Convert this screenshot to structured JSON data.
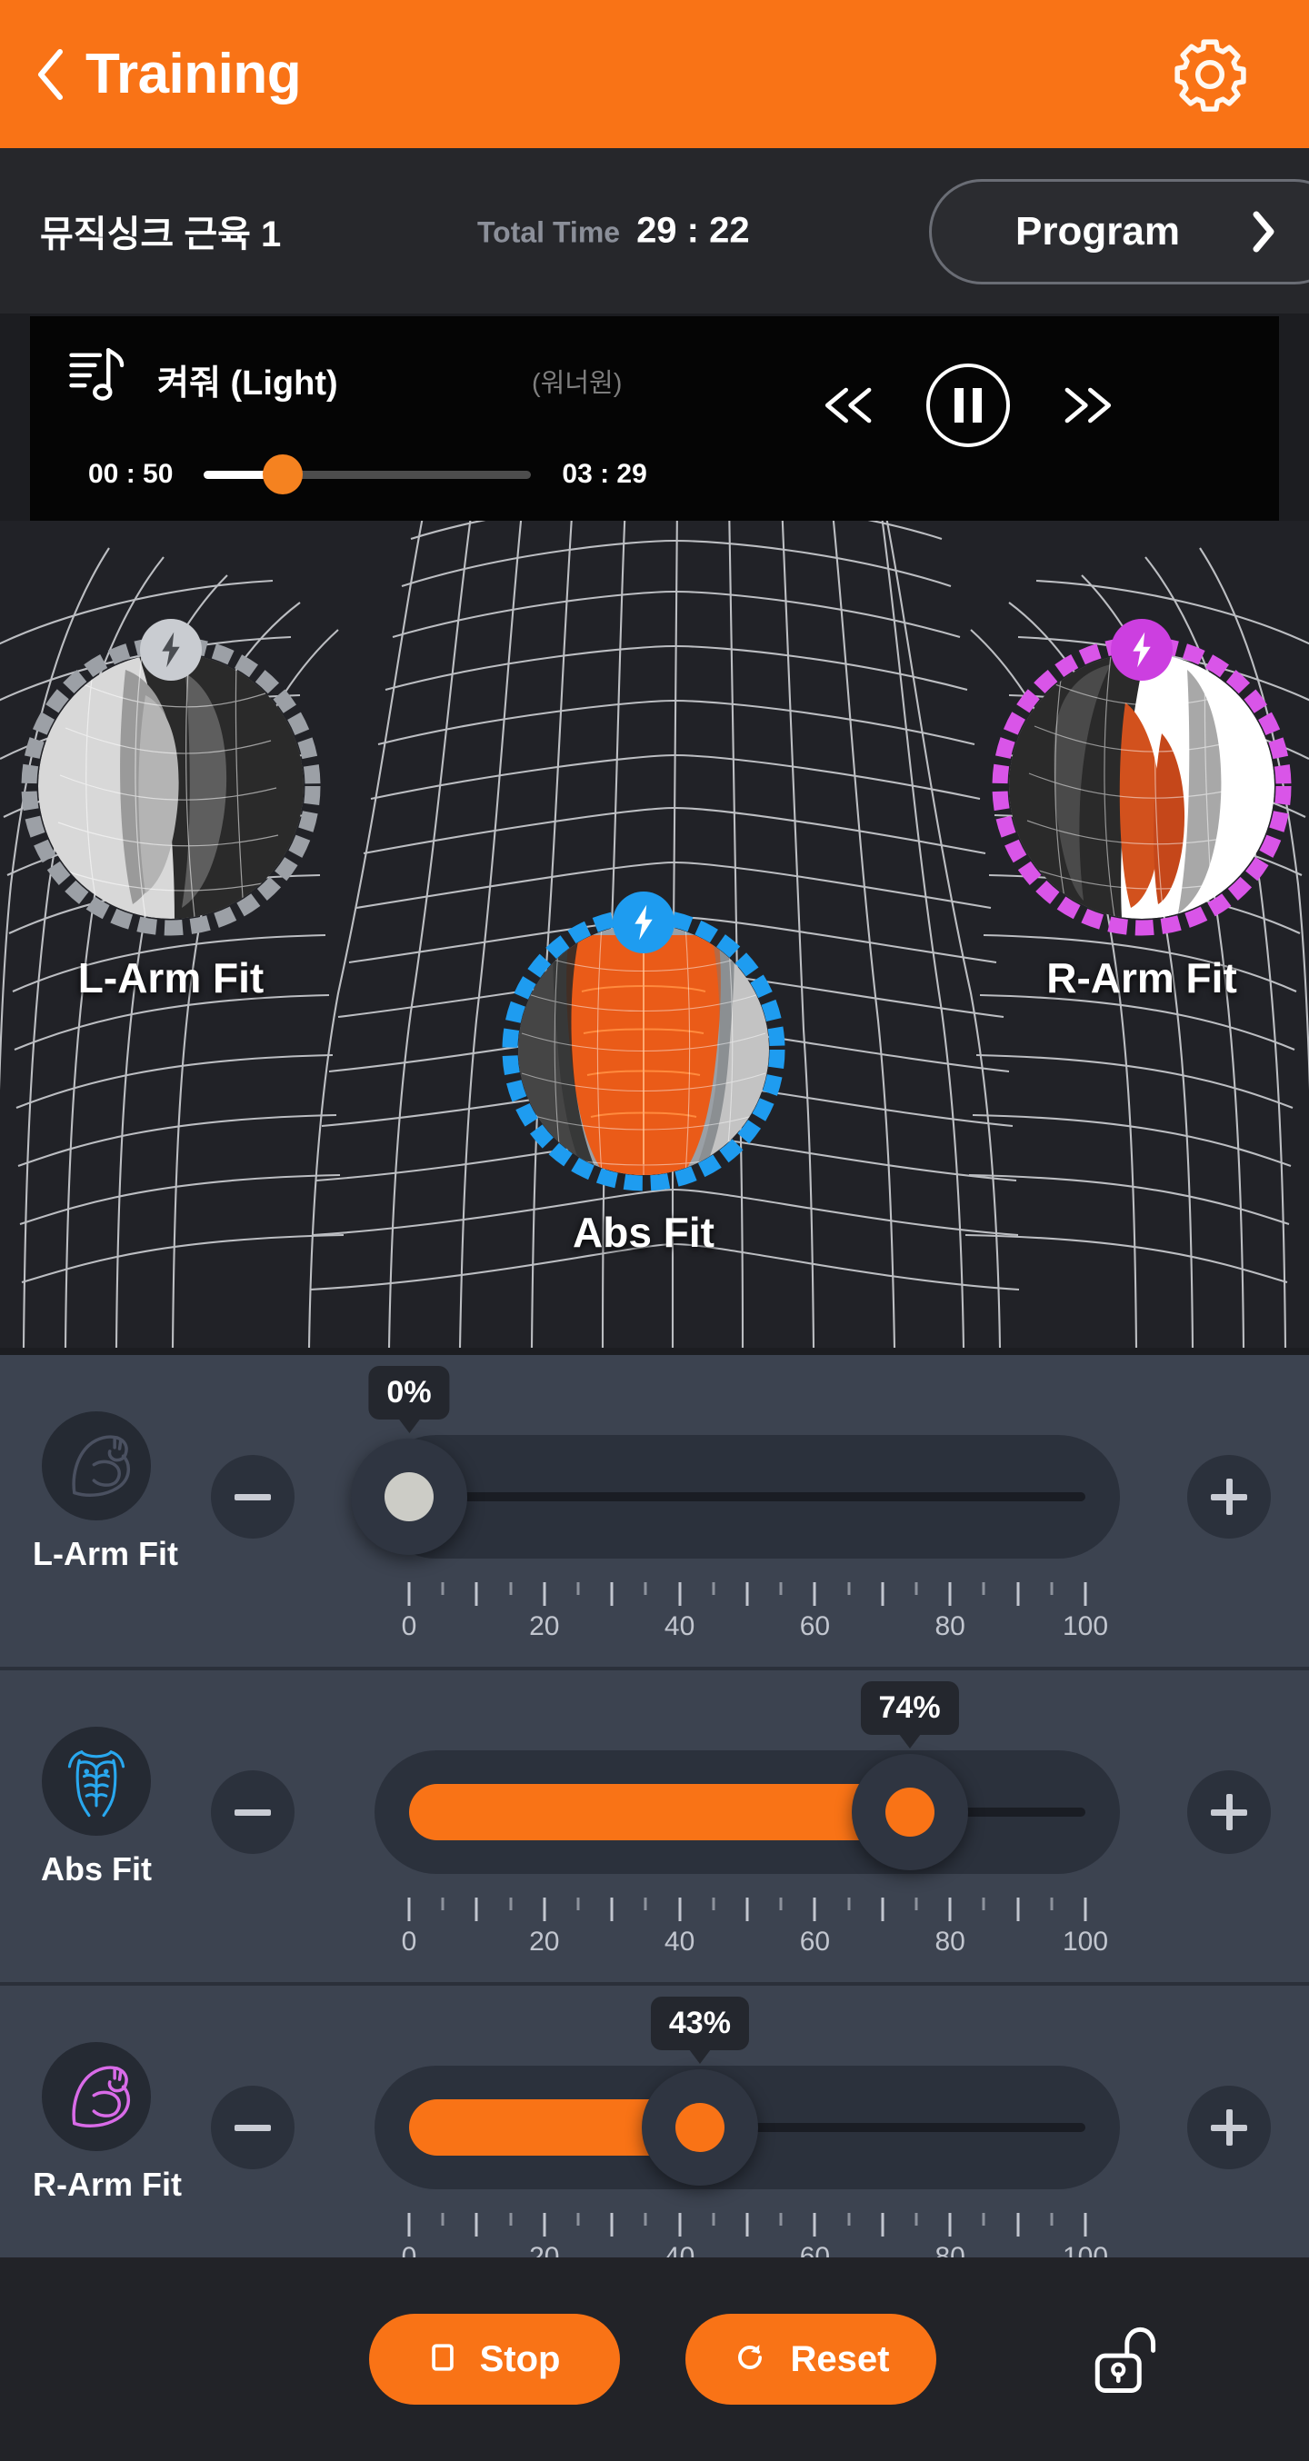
{
  "header": {
    "title": "Training",
    "back_icon": "chevron-left-icon",
    "settings_icon": "gear-icon"
  },
  "infobar": {
    "program_name": "뮤직싱크 근육 1",
    "total_time_label": "Total Time",
    "total_time_value": "29 : 22",
    "program_button_label": "Program",
    "program_button_icon": "chevron-right-icon"
  },
  "player": {
    "note_icon": "music-note-icon",
    "track_title": "켜줘 (Light)",
    "artist": "(워너원)",
    "current_time": "00 : 50",
    "total_time": "03 : 29",
    "progress_percent": 24,
    "prev_icon": "rewind-icon",
    "pause_icon": "pause-icon",
    "next_icon": "fast-forward-icon"
  },
  "body_view": {
    "nodes": [
      {
        "id": "l-arm",
        "label": "L-Arm Fit",
        "active": false,
        "ring_color": "#9ca0a6",
        "badge_color": "#c9ccd1",
        "badge_icon": "lightning-bolt-icon",
        "muscle_color": "#8d8d8d"
      },
      {
        "id": "abs",
        "label": "Abs Fit",
        "active": true,
        "ring_color": "#1e9cf0",
        "badge_color": "#1e9cf0",
        "badge_icon": "lightning-bolt-icon",
        "muscle_color": "#ea5b18"
      },
      {
        "id": "r-arm",
        "label": "R-Arm Fit",
        "active": true,
        "ring_color": "#d955e8",
        "badge_color": "#cc3fe0",
        "badge_icon": "lightning-bolt-icon",
        "muscle_color": "#d2511d"
      }
    ]
  },
  "sliders": {
    "minus_label": "−",
    "plus_label": "+",
    "scale_ticks": [
      0,
      20,
      40,
      60,
      80,
      100
    ],
    "rows": [
      {
        "id": "l-arm",
        "label": "L-Arm Fit",
        "value": 0,
        "value_text": "0%",
        "icon": "flexed-bicep-icon",
        "icon_color": "#4a5060",
        "active": false
      },
      {
        "id": "abs",
        "label": "Abs Fit",
        "value": 74,
        "value_text": "74%",
        "icon": "abs-torso-icon",
        "icon_color": "#29a8ef",
        "active": true
      },
      {
        "id": "r-arm",
        "label": "R-Arm Fit",
        "value": 43,
        "value_text": "43%",
        "icon": "flexed-bicep-icon",
        "icon_color": "#d96be8",
        "active": true
      }
    ]
  },
  "bottom_bar": {
    "stop_label": "Stop",
    "stop_icon": "stop-square-icon",
    "reset_label": "Reset",
    "reset_icon": "reset-arrow-icon",
    "lock_icon": "unlock-icon"
  },
  "colors": {
    "accent_orange": "#f97316",
    "header_orange": "#f97316",
    "panel_slate": "#3c4350",
    "dark_bg": "#1c1d21",
    "abs_blue": "#1e9cf0",
    "rarm_magenta": "#d955e8",
    "larm_gray": "#9ca0a6"
  }
}
